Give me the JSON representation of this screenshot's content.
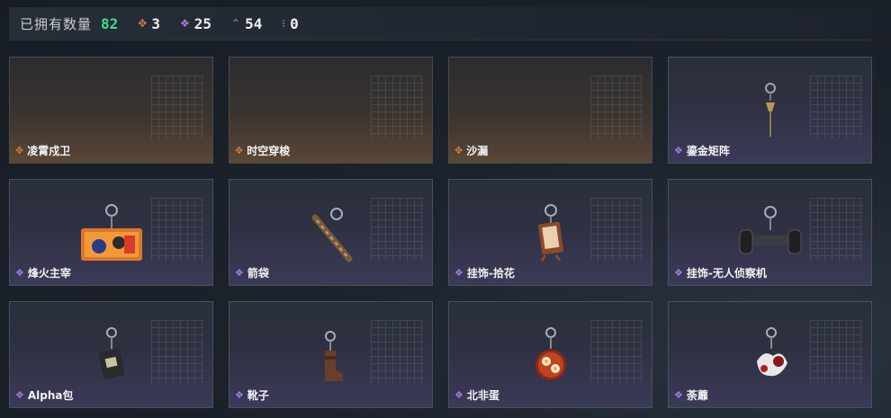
{
  "header": {
    "title": "已拥有数量",
    "total": "82",
    "stats": [
      {
        "icon": "orange-diamond-icon",
        "value": "3"
      },
      {
        "icon": "purple-diamond-icon",
        "value": "25"
      },
      {
        "icon": "blue-chevron-icon",
        "value": "54"
      },
      {
        "icon": "teal-dots-icon",
        "value": "0"
      }
    ]
  },
  "colors": {
    "orange": "#d67a3c",
    "purple": "#a57be0",
    "blue": "#59a8e8",
    "teal": "#3fd0b0",
    "total_green": "#3fdc8f"
  },
  "items": [
    {
      "name": "凌霄戍卫",
      "rarity": "orange"
    },
    {
      "name": "时空穿梭",
      "rarity": "orange"
    },
    {
      "name": "沙漏",
      "rarity": "orange"
    },
    {
      "name": "鎏金矩阵",
      "rarity": "purple"
    },
    {
      "name": "烽火主宰",
      "rarity": "purple"
    },
    {
      "name": "箭袋",
      "rarity": "purple"
    },
    {
      "name": "挂饰-拾花",
      "rarity": "purple"
    },
    {
      "name": "挂饰-无人侦察机",
      "rarity": "purple"
    },
    {
      "name": "Alpha包",
      "rarity": "purple"
    },
    {
      "name": "靴子",
      "rarity": "purple"
    },
    {
      "name": "北非蛋",
      "rarity": "purple"
    },
    {
      "name": "荼蘼",
      "rarity": "purple"
    }
  ]
}
